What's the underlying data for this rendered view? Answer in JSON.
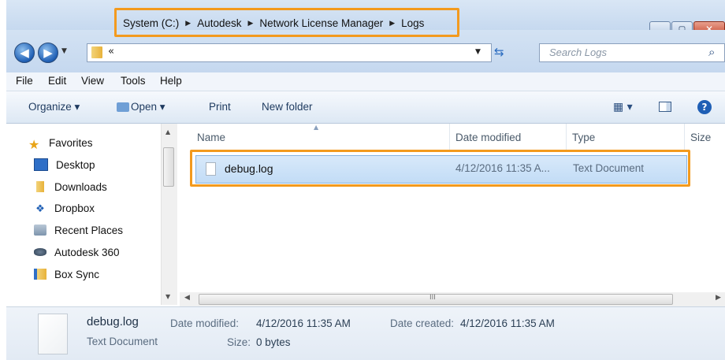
{
  "breadcrumb": {
    "overflow": "«",
    "segments": [
      "System (C:)",
      "Autodesk",
      "Network License Manager",
      "Logs"
    ]
  },
  "search": {
    "placeholder": "Search Logs"
  },
  "menu": [
    "File",
    "Edit",
    "View",
    "Tools",
    "Help"
  ],
  "toolbar": {
    "organize": "Organize ▾",
    "open": "Open ▾",
    "print": "Print",
    "new_folder": "New folder"
  },
  "sidebar": {
    "favorites": "Favorites",
    "items": [
      "Desktop",
      "Downloads",
      "Dropbox",
      "Recent Places",
      "Autodesk 360",
      "Box Sync"
    ]
  },
  "columns": {
    "name": "Name",
    "date": "Date modified",
    "type": "Type",
    "size": "Size"
  },
  "files": [
    {
      "name": "debug.log",
      "date": "4/12/2016 11:35 A...",
      "type": "Text Document"
    }
  ],
  "details": {
    "filename": "debug.log",
    "filetype": "Text Document",
    "date_modified_label": "Date modified:",
    "date_modified": "4/12/2016 11:35 AM",
    "date_created_label": "Date created:",
    "date_created": "4/12/2016 11:35 AM",
    "size_label": "Size:",
    "size": "0 bytes"
  },
  "scrollbar_grip": "III",
  "colors": {
    "highlight": "#f39a1e",
    "selection": "#c2dcf6",
    "folder": "#e8b23a",
    "accent_blue": "#1f5fb5"
  },
  "icons": [
    "back-icon",
    "forward-icon",
    "folder-icon",
    "refresh-icon",
    "search-icon",
    "help-icon",
    "views-icon",
    "preview-pane-icon",
    "star-icon",
    "desktop-icon",
    "downloads-icon",
    "dropbox-icon",
    "recent-places-icon",
    "autodesk360-icon",
    "box-sync-icon",
    "text-file-icon"
  ]
}
